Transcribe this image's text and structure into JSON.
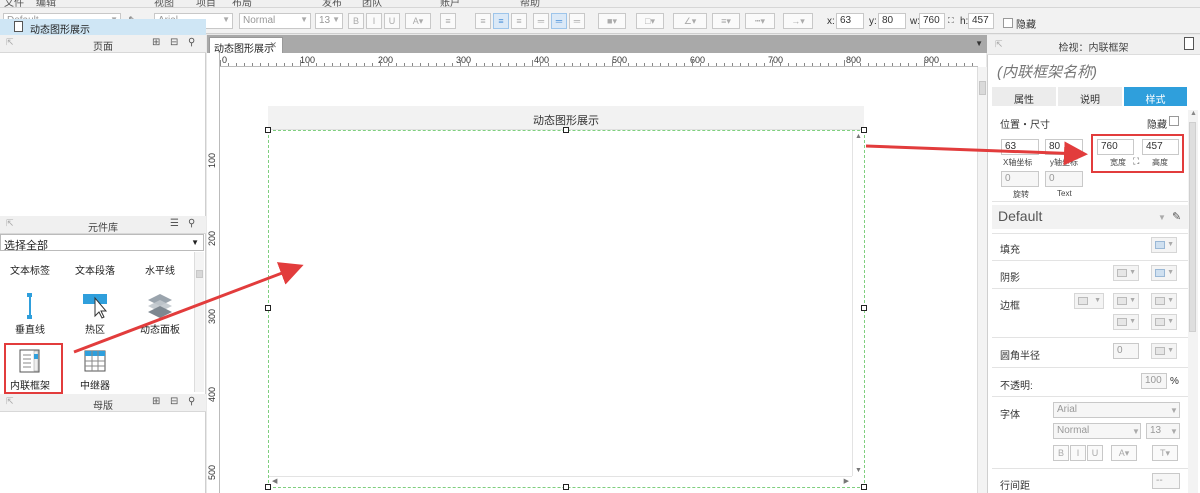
{
  "menubar": {
    "items": [
      "文件",
      "编辑",
      "视图",
      "项目",
      "布局",
      "发布",
      "团队",
      "账户",
      "帮助"
    ]
  },
  "toolbar": {
    "style_value": "Default",
    "font_value": "Arial",
    "weight_value": "Normal",
    "size_value": "13",
    "bold": "B",
    "italic": "I",
    "underline": "U",
    "x_label": "x:",
    "x_value": "63",
    "y_label": "y:",
    "y_value": "80",
    "w_label": "w:",
    "w_value": "760",
    "h_label": "h:",
    "h_value": "457",
    "hidden_label": "隐藏"
  },
  "pages_panel": {
    "title": "页面",
    "items": [
      {
        "label": "动态图形展示"
      }
    ]
  },
  "library_panel": {
    "title": "元件库",
    "select_value": "选择全部",
    "widgets": [
      {
        "label": "文本标签",
        "icon": "text-label-icon"
      },
      {
        "label": "文本段落",
        "icon": "text-paragraph-icon"
      },
      {
        "label": "水平线",
        "icon": "horizontal-line-icon"
      },
      {
        "label": "垂直线",
        "icon": "vertical-line-icon"
      },
      {
        "label": "热区",
        "icon": "hotspot-icon"
      },
      {
        "label": "动态面板",
        "icon": "dynamic-panel-icon"
      },
      {
        "label": "内联框架",
        "icon": "inline-frame-icon"
      },
      {
        "label": "中继器",
        "icon": "repeater-icon"
      }
    ]
  },
  "masters_panel": {
    "title": "母版"
  },
  "canvas": {
    "tab_label": "动态图形展示",
    "ruler_top": [
      "0",
      "100",
      "200",
      "300",
      "400",
      "500",
      "600",
      "700",
      "800",
      "900"
    ],
    "ruler_left": [
      "100",
      "200",
      "300",
      "400",
      "500"
    ],
    "frame_title": "动态图形展示"
  },
  "inspector": {
    "title": "检视：内联框架",
    "widget_name_placeholder": "(内联框架名称)",
    "tabs": [
      "属性",
      "说明",
      "样式"
    ],
    "active_tab": "样式",
    "position_size_label": "位置・尺寸",
    "hide_label": "隐藏",
    "x_value": "63",
    "x_caption": "X轴坐标",
    "y_value": "80",
    "y_caption": "y轴坐标",
    "w_value": "760",
    "w_caption": "宽度",
    "h_value": "457",
    "h_caption": "高度",
    "rotation_value": "0",
    "rotation_caption": "旋转",
    "text_rotation_value": "0",
    "text_rotation_caption": "Text",
    "style_value": "Default",
    "fill_label": "填充",
    "shadow_label": "阴影",
    "border_label": "边框",
    "radius_label": "圆角半径",
    "radius_value": "0",
    "opacity_label": "不透明:",
    "opacity_value": "100",
    "opacity_unit": "%",
    "font_label": "字体",
    "font_value": "Arial",
    "weight_value": "Normal",
    "size_value": "13",
    "line_spacing_label": "行间距",
    "line_spacing_value": "--"
  },
  "colors": {
    "accent": "#2f9fdc",
    "annotation": "#e23c3c",
    "selection": "#7fcf7f"
  }
}
